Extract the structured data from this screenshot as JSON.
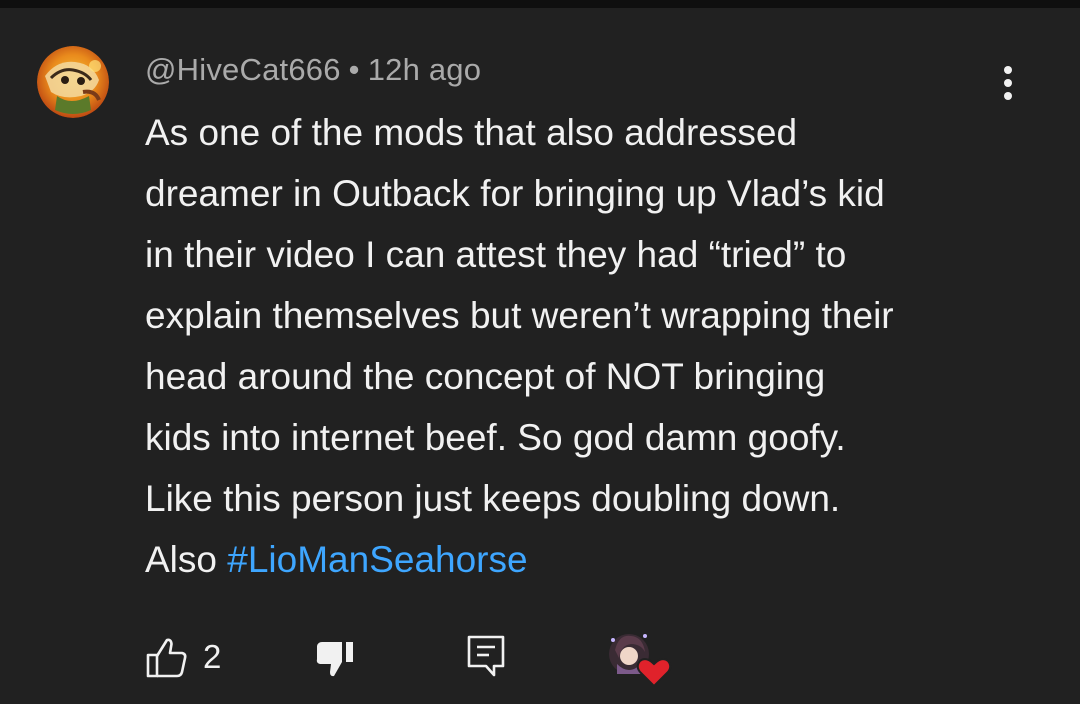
{
  "comment": {
    "author": "@HiveCat666",
    "separator": "•",
    "time": "12h ago",
    "body": "As one of the mods that also addressed\ndreamer in Outback for bringing up Vlad’s kid\nin their video I can attest they had “tried” to\nexplain themselves but weren’t wrapping their\nhead around the concept of NOT bringing\nkids into internet beef. So god damn goofy.\nLike this person just keeps doubling down.\nAlso ",
    "hashtag": "#LioManSeahorse"
  },
  "actions": {
    "like_count": "2",
    "like_icon": "thumb-up-outline-icon",
    "dislike_icon": "thumb-down-filled-icon",
    "reply_icon": "comment-reply-icon",
    "more_icon": "three-dots-vertical-icon",
    "hearted_icon": "creator-heart-icon"
  },
  "colors": {
    "background": "#212121",
    "text": "#f1f1f1",
    "meta": "#aaaaaa",
    "link": "#3ea6ff",
    "heart": "#e0222b"
  }
}
